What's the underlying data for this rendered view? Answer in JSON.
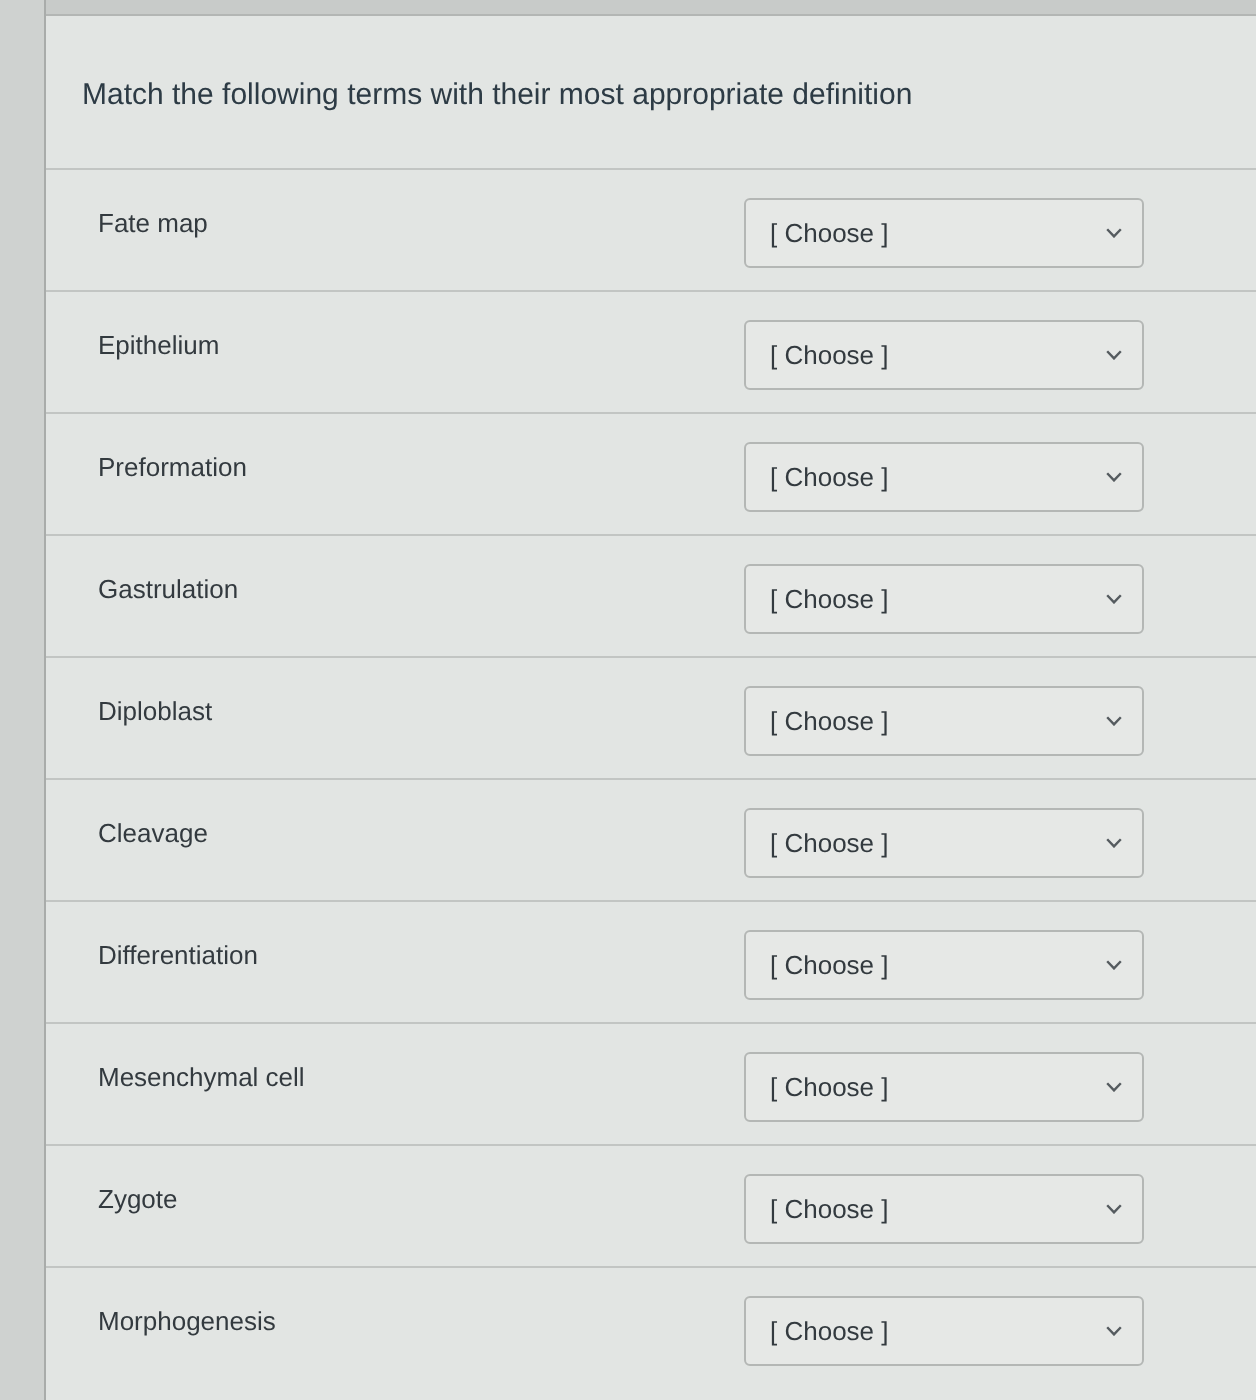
{
  "question": "Match the following terms with their most appropriate definition",
  "items": [
    {
      "term": "Fate map",
      "value": "[ Choose ]"
    },
    {
      "term": "Epithelium",
      "value": "[ Choose ]"
    },
    {
      "term": "Preformation",
      "value": "[ Choose ]"
    },
    {
      "term": "Gastrulation",
      "value": "[ Choose ]"
    },
    {
      "term": "Diploblast",
      "value": "[ Choose ]"
    },
    {
      "term": "Cleavage",
      "value": "[ Choose ]"
    },
    {
      "term": "Differentiation",
      "value": "[ Choose ]"
    },
    {
      "term": "Mesenchymal cell",
      "value": "[ Choose ]"
    },
    {
      "term": "Zygote",
      "value": "[ Choose ]"
    },
    {
      "term": "Morphogenesis",
      "value": "[ Choose ]"
    }
  ]
}
